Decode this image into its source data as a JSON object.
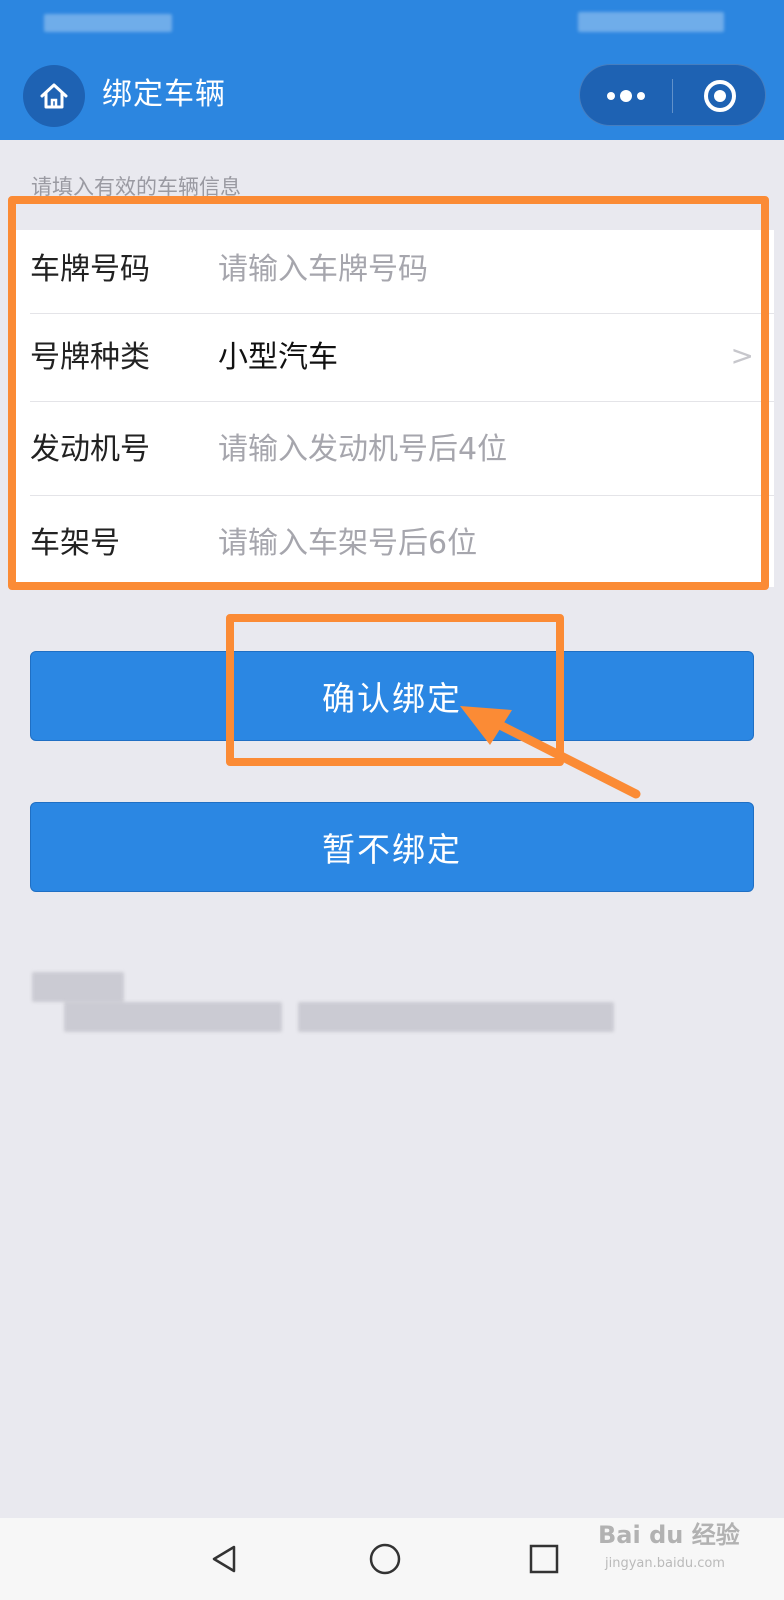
{
  "header": {
    "title": "绑定车辆",
    "background": "#2c86e0",
    "icons": {
      "home": "home-icon",
      "more": "more-dots-icon",
      "close": "target-circle-icon"
    }
  },
  "form": {
    "hint": "请填入有效的车辆信息",
    "fields": [
      {
        "label": "车牌号码",
        "placeholder": "请输入车牌号码",
        "value": ""
      },
      {
        "label": "号牌种类",
        "value": "小型汽车",
        "chevron": ">"
      },
      {
        "label": "发动机号",
        "placeholder": "请输入发动机号后4位",
        "value": ""
      },
      {
        "label": "车架号",
        "placeholder": "请输入车架号后6位",
        "value": ""
      }
    ]
  },
  "actions": {
    "confirm_label": "确认绑定",
    "skip_label": "暂不绑定",
    "button_color": "#2b87e3",
    "highlight_color": "#fb8b35"
  },
  "watermark": {
    "brand": "Bai du 经验",
    "url": "jingyan.baidu.com"
  }
}
